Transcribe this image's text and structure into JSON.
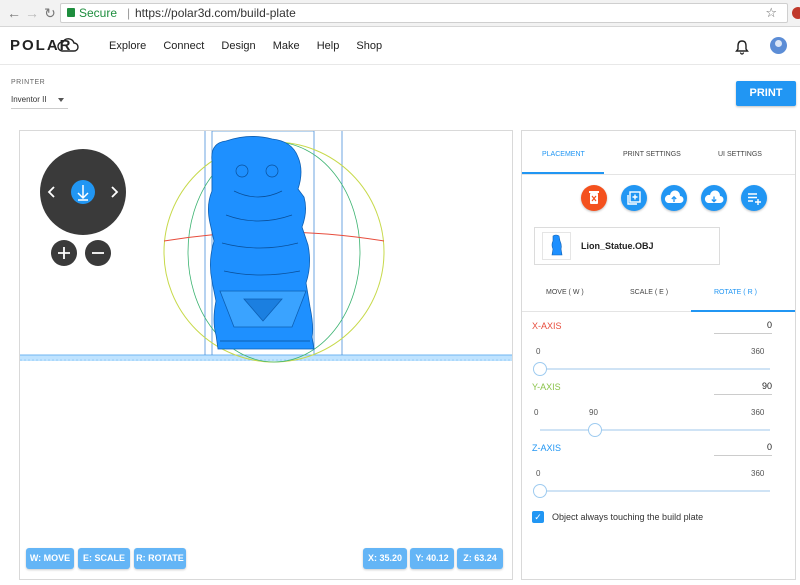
{
  "browser": {
    "secure_label": "Secure",
    "url": "https://polar3d.com/build-plate",
    "separator": "|"
  },
  "header": {
    "logo": "POLAR",
    "nav": [
      "Explore",
      "Connect",
      "Design",
      "Make",
      "Help",
      "Shop"
    ]
  },
  "printer": {
    "label": "PRINTER",
    "selected": "Inventor II",
    "print_button": "PRINT"
  },
  "viewer": {
    "controls": {
      "move": "W: MOVE",
      "scale": "E: SCALE",
      "rotate": "R: ROTATE"
    },
    "coords": {
      "x": "X: 35.20",
      "y": "Y: 40.12",
      "z": "Z: 63.24"
    }
  },
  "panel": {
    "tabs": [
      "PLACEMENT",
      "PRINT SETTINGS",
      "UI SETTINGS"
    ],
    "active_tab": "PLACEMENT",
    "file_name": "Lion_Statue.OBJ",
    "subtabs": [
      "MOVE ( W )",
      "SCALE ( E )",
      "ROTATE ( R )"
    ],
    "active_subtab": "ROTATE ( R )",
    "axes": [
      {
        "label": "X-AXIS",
        "value": "0",
        "min": "0",
        "max": "360",
        "current_label": "",
        "color": "#e74c3c",
        "level": 0
      },
      {
        "label": "Y-AXIS",
        "value": "90",
        "min": "0",
        "max": "360",
        "current_label": "90",
        "color": "#8bc34a",
        "level": 0.25
      },
      {
        "label": "Z-AXIS",
        "value": "0",
        "min": "0",
        "max": "360",
        "current_label": "",
        "color": "#2196f3",
        "level": 0
      }
    ],
    "checkbox_label": "Object always touching the build plate",
    "checkbox_checked": true
  },
  "colors": {
    "accent": "#2196f3",
    "delete": "#f4511e",
    "model": "#1e90ff"
  }
}
